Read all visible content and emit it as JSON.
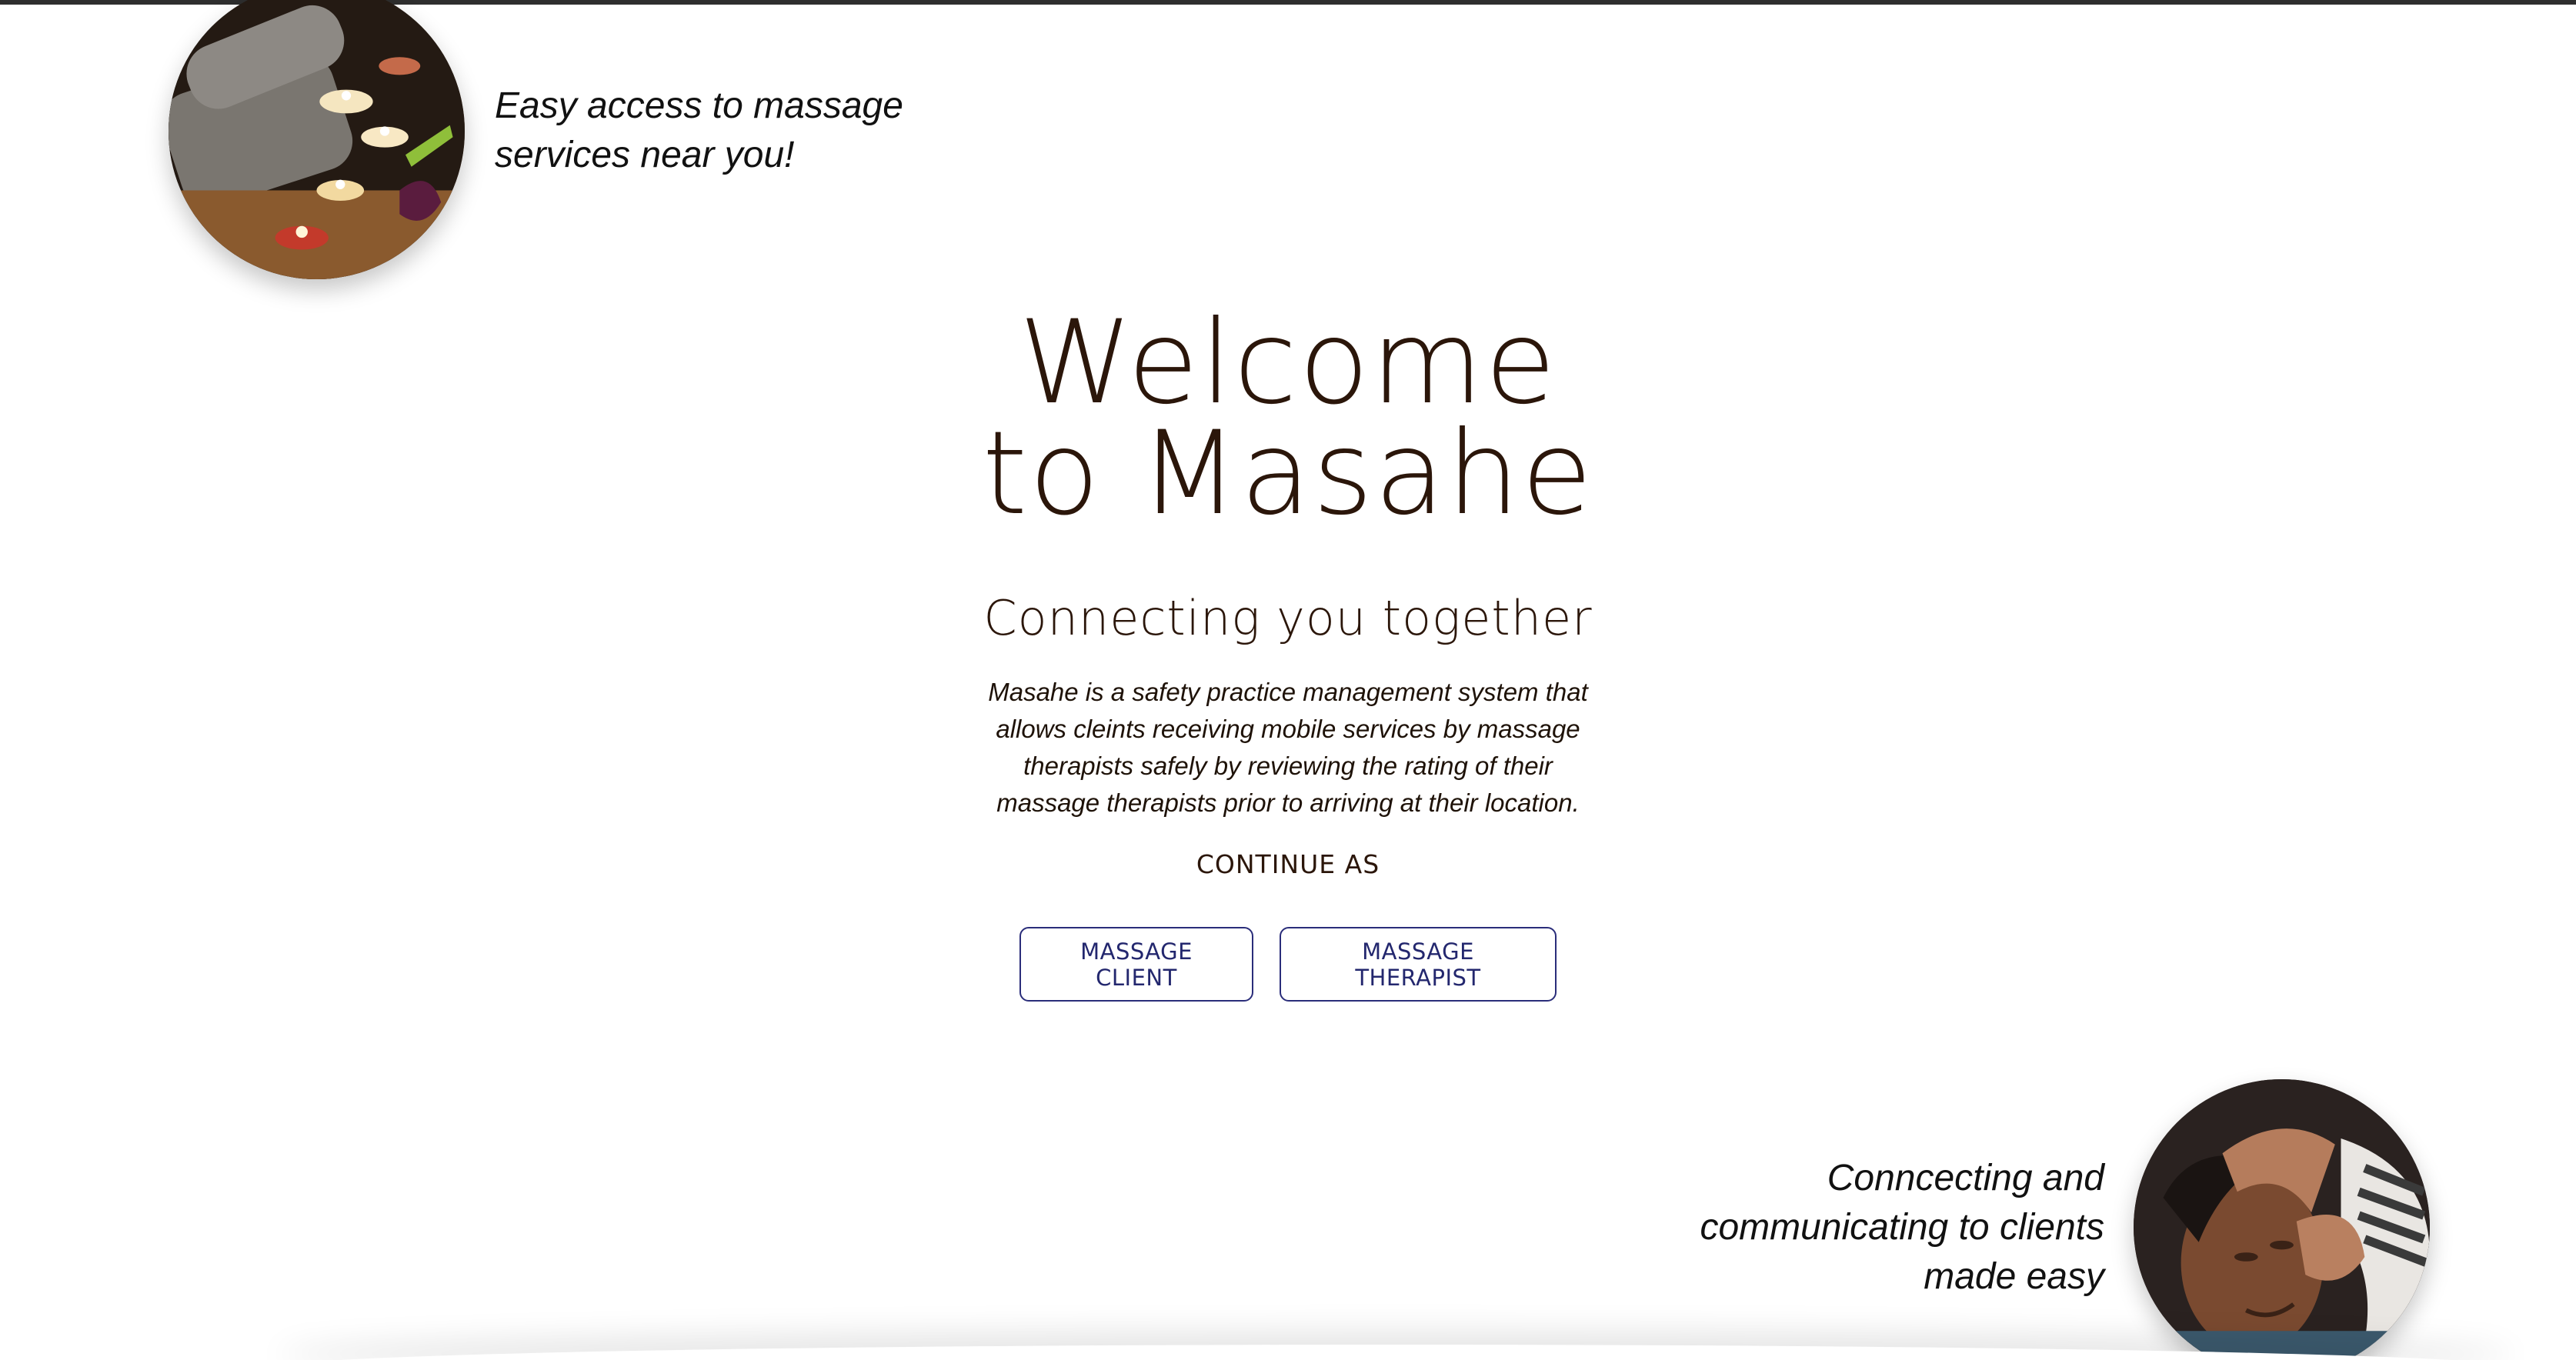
{
  "taglines": {
    "top": [
      "Easy access to massage",
      "services near you!"
    ],
    "bottom": [
      "Conncecting and",
      "communicating to clients",
      "made easy"
    ]
  },
  "hero": {
    "title_line1": "Welcome",
    "title_line2": "to Masahe",
    "subtitle": "Connecting you together",
    "description": "Masahe is a safety practice management system that allows cleints receiving mobile services by massage therapists safely by reviewing the rating of their massage therapists prior to arriving at their location.",
    "continue_label": "CONTINUE AS"
  },
  "buttons": {
    "client_label": "MASSAGE CLIENT",
    "therapist_label": "MASSAGE THERAPIST"
  },
  "colors": {
    "heading": "#2b160a",
    "button_border": "#2a2d7a",
    "button_text": "#23276e",
    "background": "#ffffff"
  },
  "images": {
    "top_circle": "spa-candles-towels-photo",
    "bottom_circle": "face-massage-photo"
  }
}
